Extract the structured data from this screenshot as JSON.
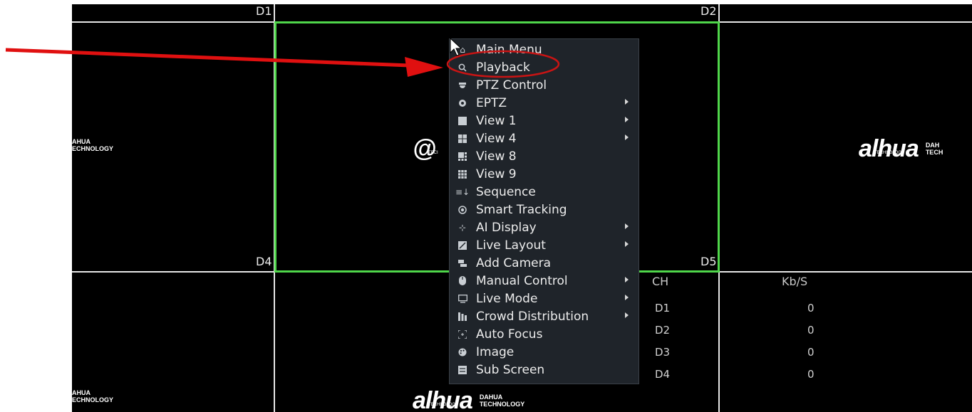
{
  "tiles": {
    "top_left_label": "D1",
    "top_center_label": "D2",
    "mid_left_label": "D4",
    "mid_center_label": "D5"
  },
  "logo": {
    "brand_mark": "alhua",
    "brand_sub": "TECHNOLOGY",
    "line1": "DAHUA",
    "line2": "TECHNOLOGY",
    "partial_line1": "AHUA",
    "partial_line2": "ECHNOLOGY",
    "right_partial_line1": "DAH",
    "right_partial_line2": "TECH",
    "center_partial_sub": "TECI"
  },
  "stats": {
    "col_ch": "CH",
    "col_rate": "Kb/S",
    "rows": [
      {
        "ch": "D1",
        "rate": "0"
      },
      {
        "ch": "D2",
        "rate": "0"
      },
      {
        "ch": "D3",
        "rate": "0"
      },
      {
        "ch": "D4",
        "rate": "0"
      }
    ]
  },
  "menu": {
    "items": [
      {
        "label": "Main Menu",
        "icon": "home-icon",
        "submenu": false
      },
      {
        "label": "Playback",
        "icon": "search-icon",
        "submenu": false
      },
      {
        "label": "PTZ Control",
        "icon": "ptz-dome-icon",
        "submenu": false
      },
      {
        "label": "EPTZ",
        "icon": "eptz-icon",
        "submenu": true
      },
      {
        "label": "View 1",
        "icon": "view1-icon",
        "submenu": true
      },
      {
        "label": "View 4",
        "icon": "view4-icon",
        "submenu": true
      },
      {
        "label": "View 8",
        "icon": "view8-icon",
        "submenu": false
      },
      {
        "label": "View 9",
        "icon": "view9-icon",
        "submenu": false
      },
      {
        "label": "Sequence",
        "icon": "sequence-icon",
        "submenu": false
      },
      {
        "label": "Smart Tracking",
        "icon": "smart-tracking-icon",
        "submenu": false
      },
      {
        "label": "AI Display",
        "icon": "ai-display-icon",
        "submenu": true
      },
      {
        "label": "Live Layout",
        "icon": "live-layout-icon",
        "submenu": true
      },
      {
        "label": "Add Camera",
        "icon": "add-camera-icon",
        "submenu": false
      },
      {
        "label": "Manual Control",
        "icon": "mouse-icon",
        "submenu": true
      },
      {
        "label": "Live Mode",
        "icon": "monitor-icon",
        "submenu": true
      },
      {
        "label": "Crowd Distribution",
        "icon": "crowd-icon",
        "submenu": true
      },
      {
        "label": "Auto Focus",
        "icon": "focus-icon",
        "submenu": false
      },
      {
        "label": "Image",
        "icon": "palette-icon",
        "submenu": false
      },
      {
        "label": "Sub Screen",
        "icon": "sub-screen-icon",
        "submenu": false
      }
    ]
  },
  "colors": {
    "selection_border": "#4fd64a",
    "annotation_red": "#e01010",
    "menu_bg": "#1f242a"
  }
}
